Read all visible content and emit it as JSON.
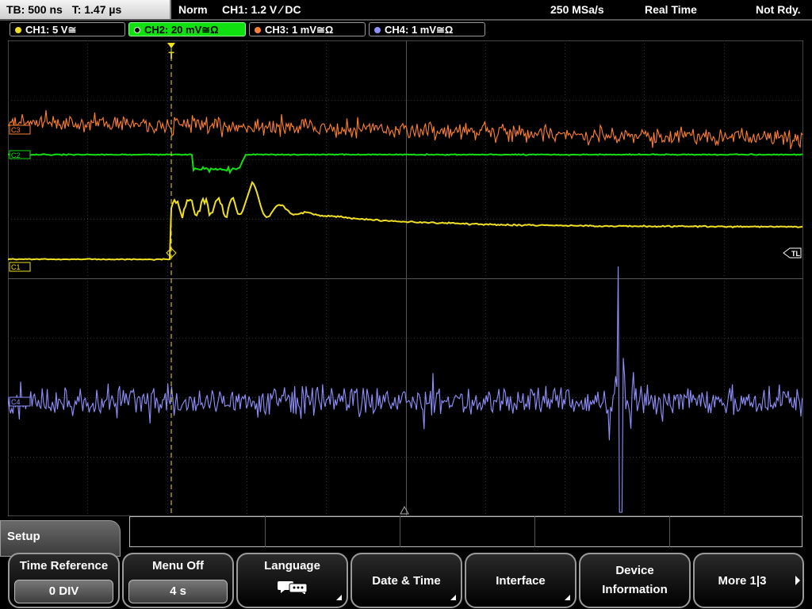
{
  "status": {
    "timebase": "TB: 500 ns",
    "trigger_time": "T: 1.47 µs",
    "trigger_mode": "Norm",
    "trigger_setting": "CH1: 1.2 V ⁄ DC",
    "sample_rate": "250 MSa/s",
    "acquisition_mode": "Real Time",
    "state": "Not Rdy."
  },
  "channels": [
    {
      "label": "CH1: 5 V≅",
      "color": "#f0e020",
      "active": false
    },
    {
      "label": "CH2: 20 mV≅Ω",
      "color": "#10e010",
      "active": true
    },
    {
      "label": "CH3: 1 mV≅Ω",
      "color": "#ff8030",
      "active": false
    },
    {
      "label": "CH4: 1 mV≅Ω",
      "color": "#9090ff",
      "active": false
    }
  ],
  "markers": {
    "ch3": "C3",
    "ch2": "C2",
    "ch1": "C1",
    "ch4": "C4",
    "trigger_level": "TL",
    "trigger_position": "T"
  },
  "menu": {
    "title": "Setup",
    "softkeys": [
      {
        "label": "Time Reference",
        "value": "0 DIV"
      },
      {
        "label": "Menu Off",
        "value": "4 s"
      },
      {
        "label": "Language",
        "icon": "speech-bubbles-icon"
      },
      {
        "label": "Date & Time"
      },
      {
        "label": "Interface"
      },
      {
        "label": "Device",
        "label2": "Information"
      },
      {
        "label": "More 1|3"
      }
    ]
  }
}
